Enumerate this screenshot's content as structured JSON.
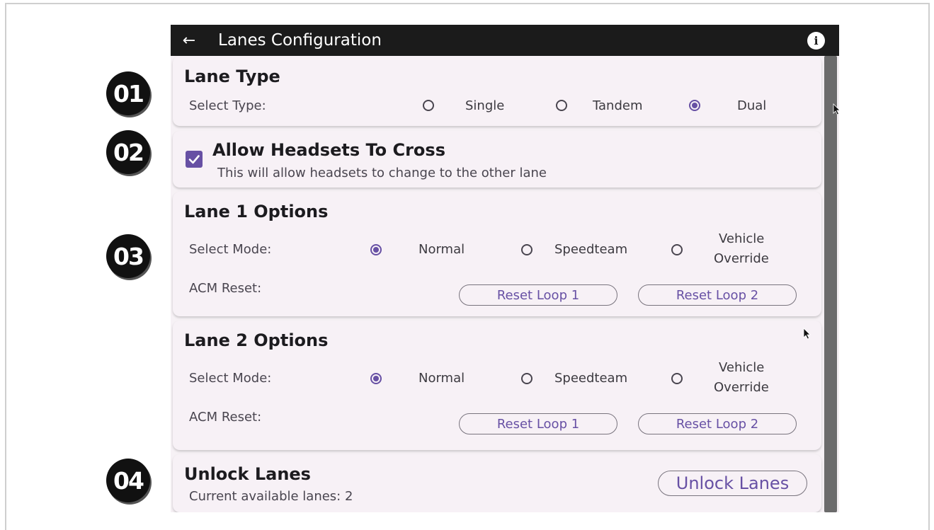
{
  "badges": [
    "01",
    "02",
    "03",
    "04"
  ],
  "app": {
    "title": "Lanes Configuration",
    "back_icon": "arrow-left-icon",
    "info_icon": "info-icon",
    "info_glyph": "i",
    "back_glyph": "←"
  },
  "lane_type": {
    "title": "Lane Type",
    "label": "Select Type:",
    "options": [
      {
        "label": "Single",
        "selected": false
      },
      {
        "label": "Tandem",
        "selected": false
      },
      {
        "label": "Dual",
        "selected": true
      }
    ]
  },
  "cross": {
    "title": "Allow Headsets To Cross",
    "description": "This will allow headsets to change to the other lane",
    "checked": true
  },
  "lane1": {
    "title": "Lane 1 Options",
    "mode_label": "Select Mode:",
    "modes": [
      {
        "label": "Normal",
        "selected": true
      },
      {
        "label": "Speedteam",
        "selected": false
      },
      {
        "label_line1": "Vehicle",
        "label_line2": "Override",
        "selected": false
      }
    ],
    "acm_label": "ACM Reset:",
    "reset1": "Reset Loop 1",
    "reset2": "Reset Loop 2"
  },
  "lane2": {
    "title": "Lane 2 Options",
    "mode_label": "Select Mode:",
    "modes": [
      {
        "label": "Normal",
        "selected": true
      },
      {
        "label": "Speedteam",
        "selected": false
      },
      {
        "label_line1": "Vehicle",
        "label_line2": "Override",
        "selected": false
      }
    ],
    "acm_label": "ACM Reset:",
    "reset1": "Reset Loop 1",
    "reset2": "Reset Loop 2"
  },
  "unlock": {
    "title": "Unlock Lanes",
    "status": "Current available lanes: 2",
    "button": "Unlock Lanes"
  },
  "colors": {
    "accent": "#6750a4",
    "topbar": "#1b1b1b",
    "card": "#f7f1f6"
  }
}
